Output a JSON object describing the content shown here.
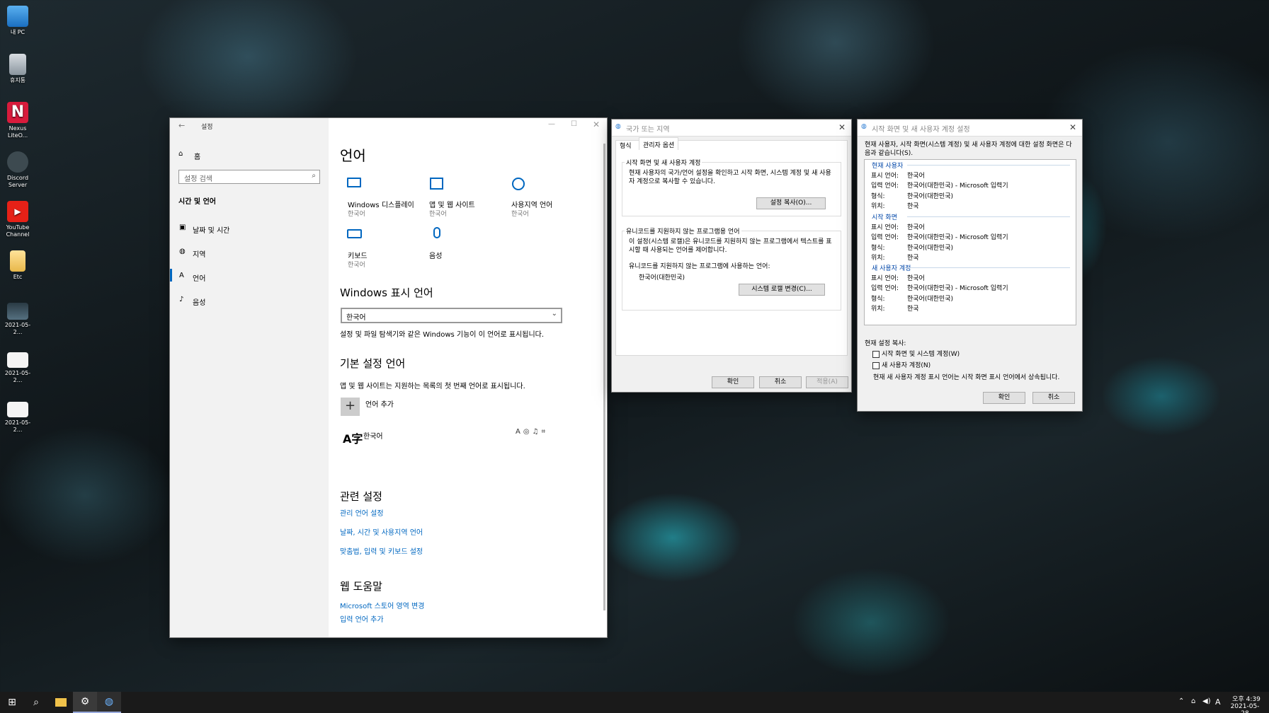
{
  "desktop": {
    "icons": [
      {
        "label": "내 PC"
      },
      {
        "label": "휴지통"
      },
      {
        "label": "Nexus LiteO..."
      },
      {
        "label": "Discord Server"
      },
      {
        "label": "YouTube Channel"
      },
      {
        "label": "Etc"
      },
      {
        "label": "2021-05-2..."
      },
      {
        "label": "2021-05-2..."
      },
      {
        "label": "2021-05-2..."
      }
    ]
  },
  "settings": {
    "title": "설정",
    "home": "홈",
    "search_placeholder": "설정 검색",
    "section": "시간 및 언어",
    "nav": [
      "날짜 및 시간",
      "지역",
      "언어",
      "음성"
    ],
    "page_title": "언어",
    "tiles": [
      {
        "label": "Windows 디스플레이",
        "sub": "한국어"
      },
      {
        "label": "앱 및 웹 사이트",
        "sub": "한국어"
      },
      {
        "label": "사용지역 언어",
        "sub": "한국어"
      },
      {
        "label": "키보드",
        "sub": "한국어"
      },
      {
        "label": "음성",
        "sub": ""
      }
    ],
    "display_lang_heading": "Windows 표시 언어",
    "display_lang_value": "한국어",
    "display_lang_desc": "설정 및 파일 탐색기와 같은 Windows 기능이 이 언어로 표시됩니다.",
    "pref_heading": "기본 설정 언어",
    "pref_desc": "앱 및 웹 사이트는 지원하는 목록의 첫 번째 언어로 표시됩니다.",
    "add_lang": "언어 추가",
    "lang_item": "한국어",
    "related_heading": "관련 설정",
    "related_links": [
      "관리 언어 설정",
      "날짜, 시간 및 사용지역 언어",
      "맞춤법, 입력 및 키보드 설정"
    ],
    "help_heading": "웹 도움말",
    "help_links": [
      "Microsoft 스토어 영역 변경",
      "입력 언어 추가"
    ]
  },
  "region": {
    "title": "국가 또는 지역",
    "tabs": [
      "형식",
      "관리자 옵션"
    ],
    "group1_title": "시작 화면 및 새 사용자 계정",
    "group1_text": "현재 사용자의 국가/언어 설정을 확인하고 시작 화면, 시스템 계정 및 새 사용자 계정으로 복사할 수 있습니다.",
    "copy_btn": "설정 복사(O)...",
    "group2_title": "유니코드를 지원하지 않는 프로그램용 언어",
    "group2_text": "이 설정(시스템 로캘)은 유니코드를 지원하지 않는 프로그램에서 텍스트를 표시할 때 사용되는 언어를 제어합니다.",
    "current_label": "유니코드를 지원하지 않는 프로그램에 사용하는 언어:",
    "current_value": "한국어(대한민국)",
    "locale_btn": "시스템 로캘 변경(C)...",
    "ok": "확인",
    "cancel": "취소",
    "apply": "적용(A)"
  },
  "welcome": {
    "title": "시작 화면 및 새 사용자 계정 설정",
    "intro": "현재 사용자, 시작 화면(시스템 계정) 및 새 사용자 계정에 대한 설정 화면은 다음과 같습니다(S).",
    "sections": [
      {
        "name": "현재 사용자",
        "rows": [
          [
            "표시 언어:",
            "한국어"
          ],
          [
            "입력 언어:",
            "한국어(대한민국) - Microsoft 입력기"
          ],
          [
            "형식:",
            "한국어(대한민국)"
          ],
          [
            "위치:",
            "한국"
          ]
        ]
      },
      {
        "name": "시작 화면",
        "rows": [
          [
            "표시 언어:",
            "한국어"
          ],
          [
            "입력 언어:",
            "한국어(대한민국) - Microsoft 입력기"
          ],
          [
            "형식:",
            "한국어(대한민국)"
          ],
          [
            "위치:",
            "한국"
          ]
        ]
      },
      {
        "name": "새 사용자 계정",
        "rows": [
          [
            "표시 언어:",
            "한국어"
          ],
          [
            "입력 언어:",
            "한국어(대한민국) - Microsoft 입력기"
          ],
          [
            "형식:",
            "한국어(대한민국)"
          ],
          [
            "위치:",
            "한국"
          ]
        ]
      }
    ],
    "copy_label": "현재 설정 복사:",
    "check1": "시작 화면 및 시스템 계정(W)",
    "check2": "새 사용자 계정(N)",
    "note": "현재 새 사용자 계정 표시 언어는 시작 화면 표시 언어에서 상속됩니다.",
    "ok": "확인",
    "cancel": "취소"
  },
  "taskbar": {
    "time": "오후 4:39",
    "date": "2021-05-28",
    "ime": "A"
  }
}
